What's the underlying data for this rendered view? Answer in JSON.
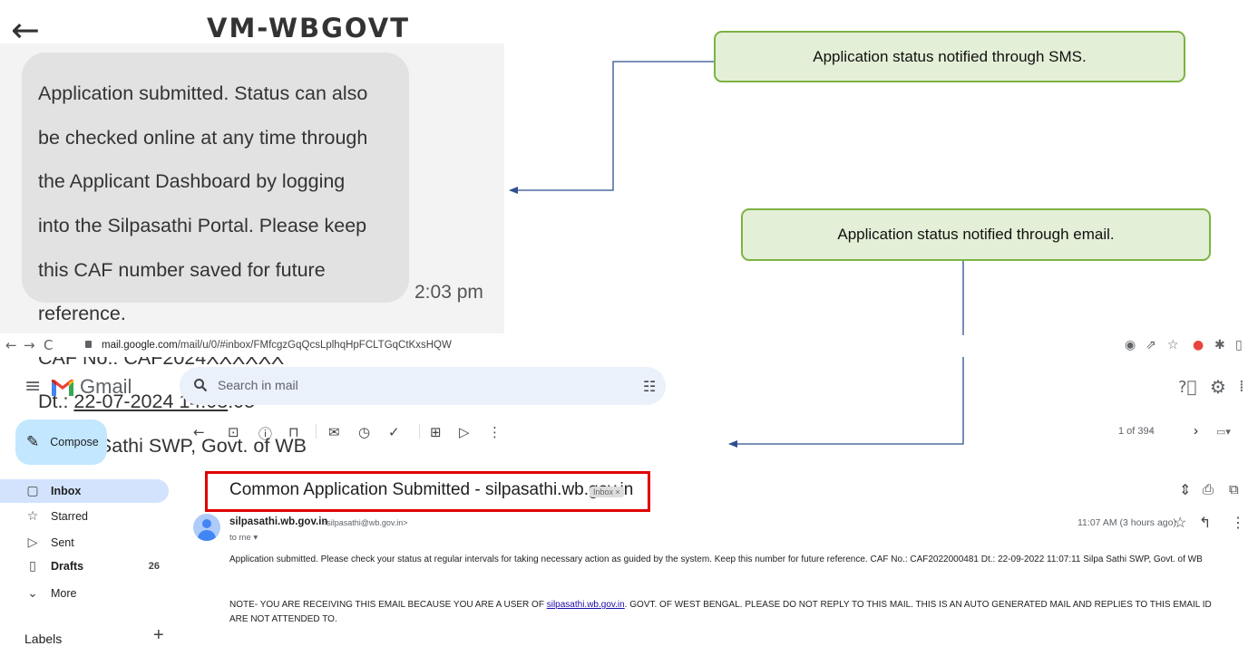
{
  "sms": {
    "back_icon": "arrow-left-icon",
    "sender": "VM-WBGOVT",
    "message_lines": [
      "Application submitted. Status can also",
      "be checked online at any time through",
      "the Applicant Dashboard by logging",
      "into the Silpasathi Portal. Please keep",
      "this CAF number saved for future",
      "reference.",
      "CAF No.: CAF2024XXXXXX"
    ],
    "date_prefix": "Dt.: ",
    "date_underlined": "22-07-2024 14:03",
    "date_suffix": ":05",
    "signature": "- Silpa Sathi SWP, Govt. of WB",
    "time": "2:03 pm"
  },
  "callouts": {
    "sms": "Application status notified through SMS.",
    "email": "Application status notified through email."
  },
  "browser": {
    "url_host": "mail.google.com",
    "url_path": "/mail/u/0/#inbox/FMfcgzGqQcsLplhqHpFCLTGqCtKxsHQW"
  },
  "gmail": {
    "app_name": "Gmail",
    "search_placeholder": "Search in mail",
    "compose_label": "Compose",
    "sidebar": [
      {
        "label": "Inbox",
        "icon": "inbox-icon",
        "count": ""
      },
      {
        "label": "Starred",
        "icon": "star-icon",
        "count": ""
      },
      {
        "label": "Sent",
        "icon": "send-icon",
        "count": ""
      },
      {
        "label": "Drafts",
        "icon": "draft-icon",
        "count": "26"
      },
      {
        "label": "More",
        "icon": "chevron-down-icon",
        "count": ""
      }
    ],
    "labels_title": "Labels",
    "labels_add": "+",
    "page_count": "1 of 394",
    "subject": "Common Application Submitted - silpasathi.wb.gov.in",
    "inbox_chip": "Inbox ×",
    "sender_name": "silpasathi.wb.gov.in",
    "sender_email": "<silpasathi@wb.gov.in>",
    "to_me": "to me ▾",
    "time": "11:07 AM (3 hours ago)",
    "body": "Application submitted. Please check your status at regular intervals for taking necessary action as guided by the system. Keep this number for future reference. CAF No.: CAF2022000481 Dt.: 22-09-2022 11:07:11 Silpa Sathi SWP, Govt. of WB",
    "note_prefix": "NOTE- YOU ARE RECEIVING THIS EMAIL BECAUSE YOU ARE A USER OF ",
    "note_link": "silpasathi.wb.gov.in",
    "note_suffix": ". GOVT. OF WEST BENGAL. PLEASE DO NOT REPLY TO THIS MAIL. THIS IS AN AUTO GENERATED MAIL AND REPLIES TO THIS EMAIL ID ARE NOT ATTENDED TO."
  },
  "colors": {
    "callout_fill": "#e3efd6",
    "callout_border": "#7cb342",
    "arrow": "#2f4f8f",
    "highlight": "#e00000",
    "compose_bg": "#c2e7ff",
    "inbox_selected": "#d3e3fd"
  }
}
